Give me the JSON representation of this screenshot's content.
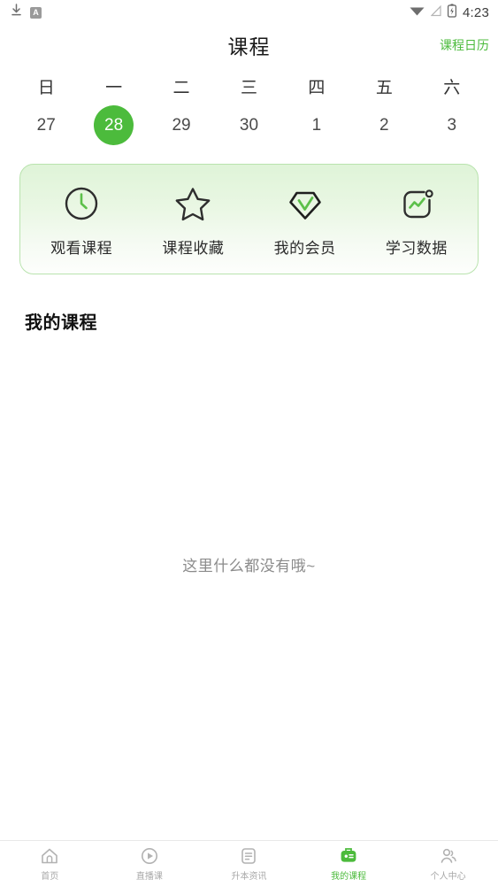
{
  "colors": {
    "brand_green": "#4CBB3C",
    "card_border": "#B9E3AE",
    "inactive_gray": "#A8A8A8"
  },
  "status_bar": {
    "time": "4:23",
    "left_icons": [
      "download-icon",
      "a-badge-icon"
    ],
    "right_icons": [
      "wifi-icon",
      "signal-icon",
      "battery-icon"
    ],
    "badge_letter": "A"
  },
  "header": {
    "title": "课程",
    "link_label": "课程日历"
  },
  "calendar": {
    "weekdays": [
      "日",
      "一",
      "二",
      "三",
      "四",
      "五",
      "六"
    ],
    "dates": [
      "27",
      "28",
      "29",
      "30",
      "1",
      "2",
      "3"
    ],
    "selected_index": 1,
    "selected_date": "28"
  },
  "quick_actions": [
    {
      "label": "观看课程",
      "icon": "clock-icon"
    },
    {
      "label": "课程收藏",
      "icon": "star-icon"
    },
    {
      "label": "我的会员",
      "icon": "diamond-check-icon"
    },
    {
      "label": "学习数据",
      "icon": "chart-icon"
    }
  ],
  "my_courses": {
    "title": "我的课程",
    "empty_text": "这里什么都没有哦~"
  },
  "bottom_nav": {
    "items": [
      {
        "label": "首页",
        "icon": "home-icon",
        "active": false
      },
      {
        "label": "直播课",
        "icon": "play-circle-icon",
        "active": false
      },
      {
        "label": "升本资讯",
        "icon": "document-icon",
        "active": false
      },
      {
        "label": "我的课程",
        "icon": "my-courses-icon",
        "active": true
      },
      {
        "label": "个人中心",
        "icon": "people-icon",
        "active": false
      }
    ]
  }
}
